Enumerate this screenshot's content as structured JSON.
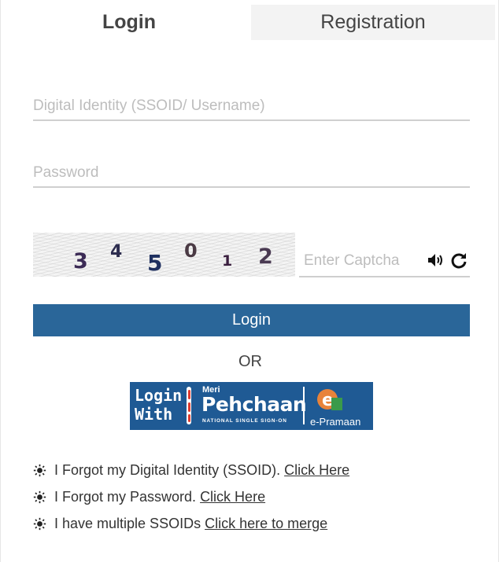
{
  "tabs": {
    "login": "Login",
    "registration": "Registration"
  },
  "form": {
    "ssoid_placeholder": "Digital Identity (SSOID/ Username)",
    "password_placeholder": "Password",
    "captcha_placeholder": "Enter Captcha",
    "captcha_digits": [
      {
        "d": "3",
        "color": "#3b2a55"
      },
      {
        "d": "4",
        "color": "#2d2d4f"
      },
      {
        "d": "5",
        "color": "#1f3060"
      },
      {
        "d": "0",
        "color": "#4a3a44"
      },
      {
        "d": "1",
        "color": "#3a1e3e"
      },
      {
        "d": "2",
        "color": "#4a3a52"
      }
    ],
    "login_button": "Login"
  },
  "or_text": "OR",
  "pehchaan": {
    "login_with": [
      "Login",
      "With"
    ],
    "meri": "Meri",
    "name": "Pehchaan",
    "subtitle": "NATIONAL SINGLE SIGN-ON",
    "e_pramaan": "e-Pramaan"
  },
  "help_links": [
    {
      "text": "I Forgot my Digital Identity (SSOID).",
      "link": "Click Here"
    },
    {
      "text": "I Forgot my Password.",
      "link": "Click Here"
    },
    {
      "text": "I have multiple SSOIDs",
      "link": "Click here to merge"
    }
  ],
  "colors": {
    "accent": "#2a6699",
    "banner": "#1f5a94"
  }
}
